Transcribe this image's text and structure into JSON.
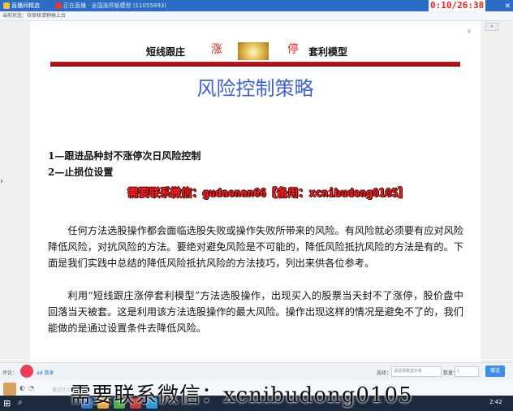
{
  "titlebar": {
    "tab1": "直播间精选",
    "tab2_prefix": "",
    "tab2": "正在直播 · 全国涨停板模型 (11055893)",
    "timer": "0:10/26:38"
  },
  "statusrow": {
    "text": "当前状态：待审核请稍候上台"
  },
  "slide": {
    "header_left": "短线跟庄",
    "header_zhang": "涨",
    "header_ting": "停",
    "header_right": "套利模型",
    "title": "风险控制策略",
    "item1": "1—跟进品种封不涨停次日风险控制",
    "item2": "2—止损位设置",
    "wechat_banner": "需要联系微信：gudaonan66【备用：xcnibudong0105】",
    "para1": "任何方法选股操作都会面临选股失败或操作失败所带来的风险。有风险就必须要有应对风险降低风险，对抗风险的方法。要绝对避免风险是不可能的，降低风险抵抗风险的方法是有的。下面是我们实践中总结的降低风险抵抗风险的方法技巧，列出来供各位参考。",
    "para2": "利用“短线跟庄涨停套利模型”方法选股操作，出现买入的股票当天封不了涨停，股价盘中回落当天被套。这是利用该方法选股操作的最大风险。操作出现这样的情况是避免不了的，我们能做的是通过设置条件去降低风险。"
  },
  "comment_bar": {
    "label": "评论：",
    "user": "ad 我来",
    "select_label": "选择：",
    "select_placeholder": "请选择赠送对象",
    "qty_label": "数量：",
    "qty_value": "1",
    "send": "赠送"
  },
  "bottom_strip": {
    "input_hint": "说点什么吧..."
  },
  "taskbar": {
    "clock": "2:42"
  },
  "overlay": {
    "watermark": "需要联系微信：xcnibudong0105"
  },
  "icons": {
    "start": "windows-start-icon",
    "search": "search-icon",
    "close": "close-icon"
  },
  "colors": {
    "title_blue": "#3f5fd2",
    "header_red": "#e0201a",
    "banner_red": "#ff1d1d",
    "timer_red": "#e52222",
    "taskbar": "#1d2a3e"
  }
}
